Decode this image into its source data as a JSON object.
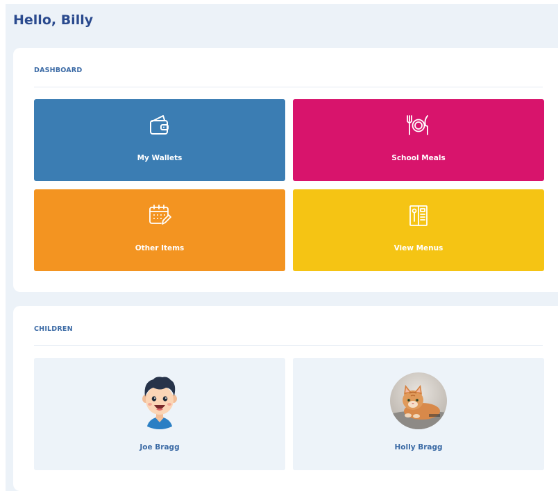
{
  "greeting": "Hello, Billy",
  "dashboard": {
    "title": "DASHBOARD",
    "tiles": [
      {
        "label": "My Wallets",
        "icon": "wallet-icon",
        "color": "#3b7db3"
      },
      {
        "label": "School Meals",
        "icon": "plate-icon",
        "color": "#d8146c"
      },
      {
        "label": "Other Items",
        "icon": "calendar-edit-icon",
        "color": "#f39421"
      },
      {
        "label": "View Menus",
        "icon": "menu-book-icon",
        "color": "#f5c414"
      }
    ]
  },
  "children": {
    "title": "CHILDREN",
    "items": [
      {
        "name": "Joe Bragg",
        "avatar": "boy-avatar"
      },
      {
        "name": "Holly Bragg",
        "avatar": "cat-photo-avatar"
      }
    ]
  }
}
